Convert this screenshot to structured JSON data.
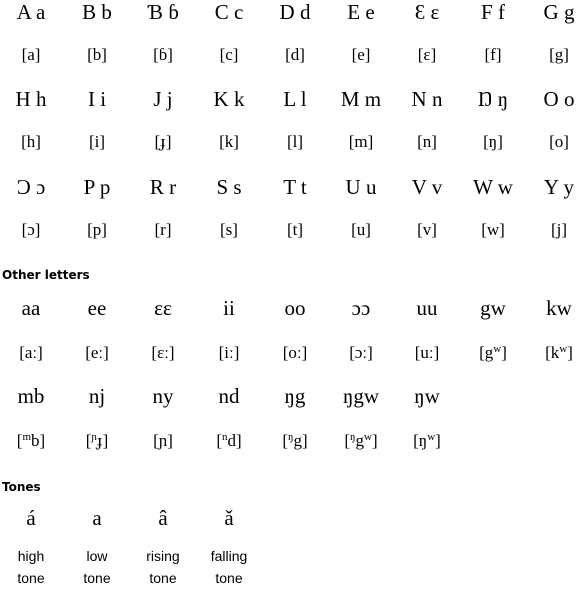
{
  "alphabet": {
    "rows": [
      {
        "letters": [
          "A a",
          "B b",
          "Ɓ ɓ",
          "C c",
          "D d",
          "E e",
          "Ɛ ɛ",
          "F f",
          "G g"
        ],
        "ipa": [
          "[a]",
          "[b]",
          "[ɓ]",
          "[c]",
          "[d]",
          "[e]",
          "[ɛ]",
          "[f]",
          "[g]"
        ]
      },
      {
        "letters": [
          "H h",
          "I i",
          "J j",
          "K k",
          "L l",
          "M m",
          "N n",
          "Ŋ ŋ",
          "O o"
        ],
        "ipa": [
          "[h]",
          "[i]",
          "[ɟ]",
          "[k]",
          "[l]",
          "[m]",
          "[n]",
          "[ŋ]",
          "[o]"
        ]
      },
      {
        "letters": [
          "Ɔ ɔ",
          "P p",
          "R r",
          "S s",
          "T t",
          "U u",
          "V v",
          "W w",
          "Y y"
        ],
        "ipa": [
          "[ɔ]",
          "[p]",
          "[r]",
          "[s]",
          "[t]",
          "[u]",
          "[v]",
          "[w]",
          "[j]"
        ]
      }
    ]
  },
  "other_letters": {
    "heading": "Other letters",
    "rows": [
      {
        "letters": [
          "aa",
          "ee",
          "ɛɛ",
          "ii",
          "oo",
          "ɔɔ",
          "uu",
          "gw",
          "kw"
        ],
        "ipa": [
          {
            "pre": "",
            "base": "[aː]",
            "sup": "",
            "post": ""
          },
          {
            "pre": "",
            "base": "[eː]",
            "sup": "",
            "post": ""
          },
          {
            "pre": "",
            "base": "[ɛː]",
            "sup": "",
            "post": ""
          },
          {
            "pre": "",
            "base": "[iː]",
            "sup": "",
            "post": ""
          },
          {
            "pre": "",
            "base": "[oː]",
            "sup": "",
            "post": ""
          },
          {
            "pre": "",
            "base": "[ɔː]",
            "sup": "",
            "post": ""
          },
          {
            "pre": "",
            "base": "[uː]",
            "sup": "",
            "post": ""
          },
          {
            "pre": "",
            "base": "[g",
            "sup": "w",
            "post": "]"
          },
          {
            "pre": "",
            "base": "[k",
            "sup": "w",
            "post": "]"
          }
        ]
      },
      {
        "letters": [
          "mb",
          "nj",
          "ny",
          "nd",
          "ŋg",
          "ŋgw",
          "ŋw"
        ],
        "ipa": [
          {
            "pre": "[",
            "presup": "m",
            "base": "b",
            "sup": "",
            "post": "]"
          },
          {
            "pre": "[",
            "presup": "ɲ",
            "base": "ɟ",
            "sup": "",
            "post": "]"
          },
          {
            "pre": "",
            "presup": "",
            "base": "[ɲ]",
            "sup": "",
            "post": ""
          },
          {
            "pre": "[",
            "presup": "n",
            "base": "d",
            "sup": "",
            "post": "]"
          },
          {
            "pre": "[",
            "presup": "ŋ",
            "base": "g",
            "sup": "",
            "post": "]"
          },
          {
            "pre": "[",
            "presup": "ŋ",
            "base": "g",
            "sup": "w",
            "post": "]"
          },
          {
            "pre": "",
            "presup": "",
            "base": "[ŋ",
            "sup": "w",
            "post": "]"
          }
        ]
      }
    ]
  },
  "tones": {
    "heading": "Tones",
    "items": [
      {
        "letter": "á",
        "label_line1": "high",
        "label_line2": "tone"
      },
      {
        "letter": "a",
        "label_line1": "low",
        "label_line2": "tone"
      },
      {
        "letter": "â",
        "label_line1": "rising",
        "label_line2": "tone"
      },
      {
        "letter": "ǎ",
        "label_line1": "falling",
        "label_line2": "tone"
      }
    ]
  }
}
